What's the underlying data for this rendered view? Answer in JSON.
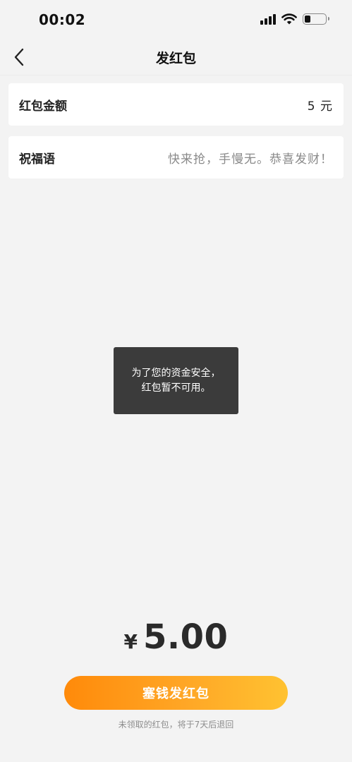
{
  "status_bar": {
    "time": "00:02",
    "battery_level": 0.3
  },
  "nav": {
    "title": "发红包",
    "back_icon": "chevron-left-icon"
  },
  "form": {
    "amount_label": "红包金额",
    "amount_value": "5 元",
    "greeting_label": "祝福语",
    "greeting_placeholder": "快来抢，手慢无。恭喜发财！"
  },
  "toast": {
    "line1": "为了您的资金安全，",
    "line2": "红包暂不可用。"
  },
  "summary": {
    "currency": "¥",
    "amount": "5.00"
  },
  "actions": {
    "send_label": "塞钱发红包",
    "footnote": "未领取的红包，将于7天后退回"
  },
  "colors": {
    "background": "#f3f3f3",
    "button_gradient_start": "#ff8a0a",
    "button_gradient_end": "#ffc231",
    "toast_bg": "#3b3b3b"
  }
}
